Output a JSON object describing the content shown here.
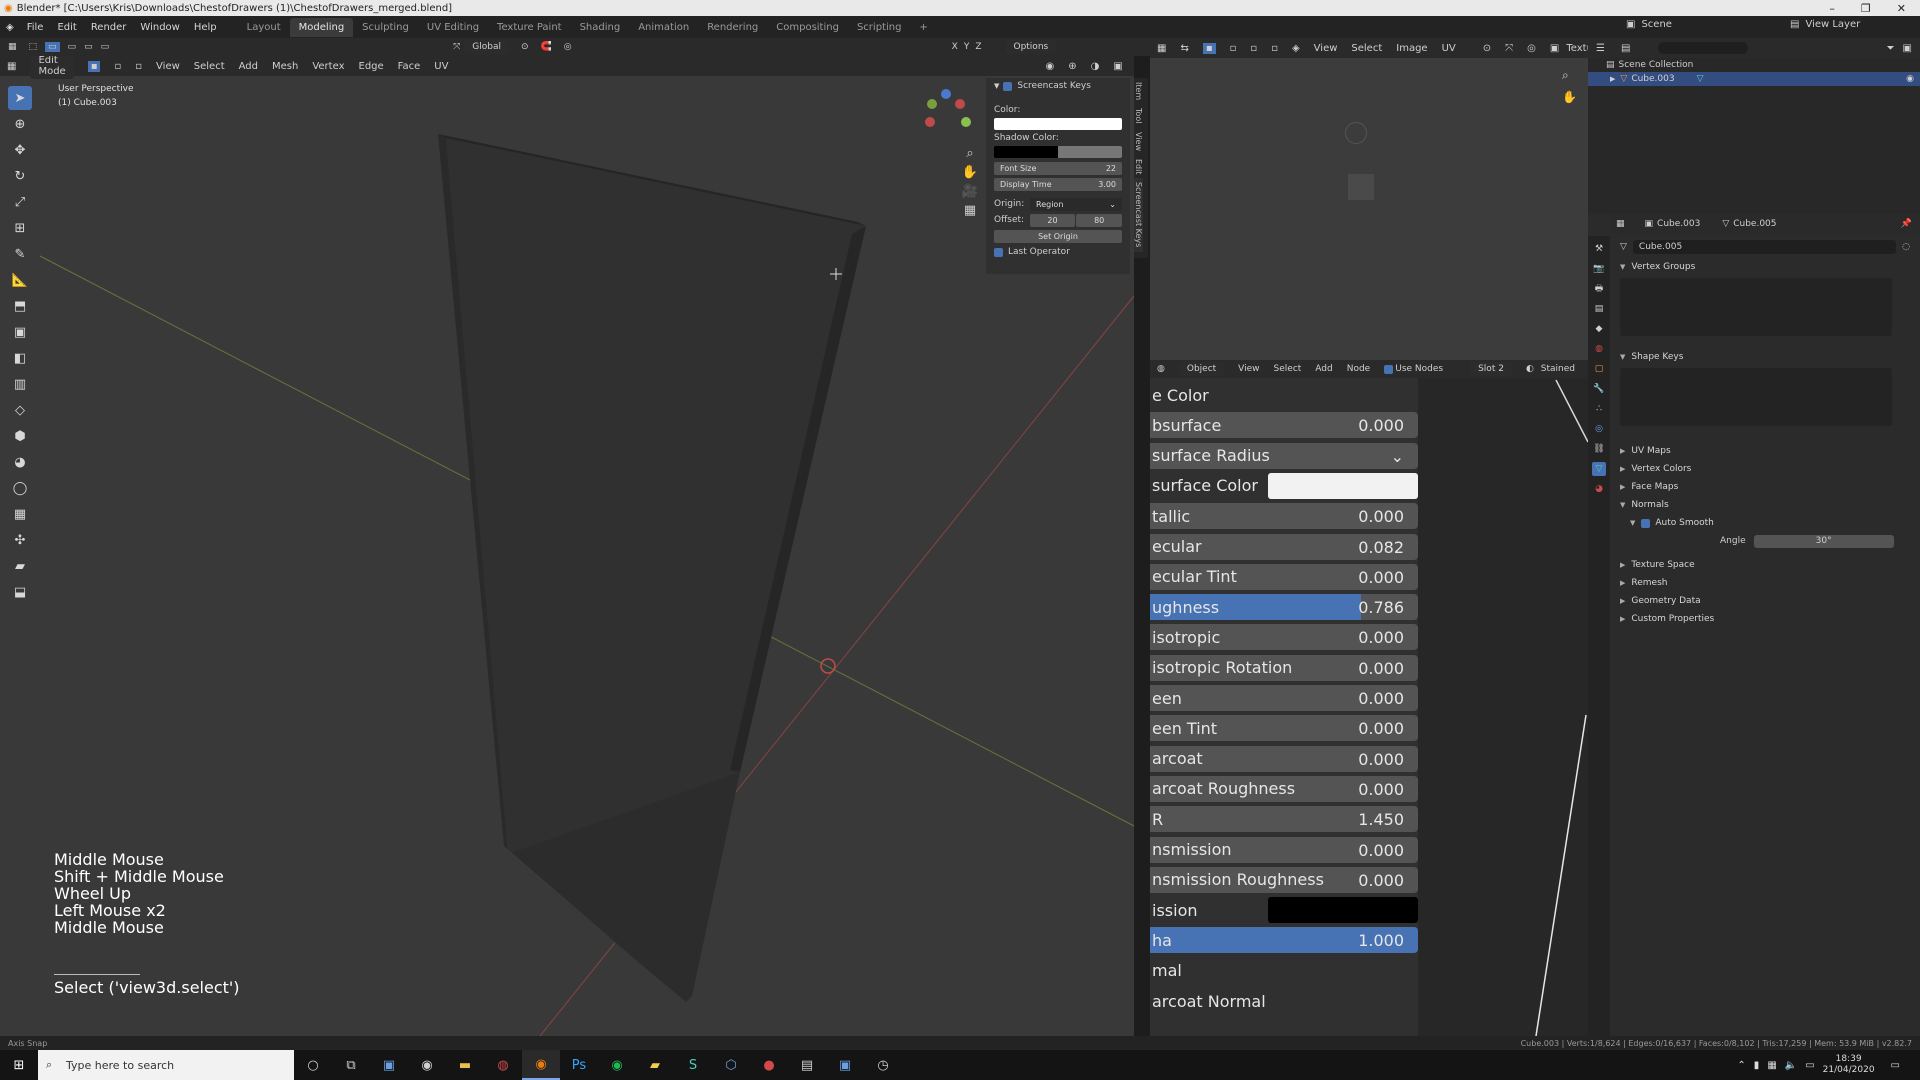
{
  "titlebar": {
    "title": "Blender* [C:\\Users\\Kris\\Downloads\\ChestofDrawers (1)\\ChestofDrawers_merged.blend]"
  },
  "topmenu": {
    "items": [
      "File",
      "Edit",
      "Render",
      "Window",
      "Help"
    ],
    "workspaces": [
      "Layout",
      "Modeling",
      "Sculpting",
      "UV Editing",
      "Texture Paint",
      "Shading",
      "Animation",
      "Rendering",
      "Compositing",
      "Scripting",
      "+"
    ],
    "active_workspace": "Modeling",
    "scene_label": "Scene",
    "view_layer_label": "View Layer"
  },
  "viewport_header": {
    "mode": "Edit Mode",
    "menus": [
      "View",
      "Select",
      "Add",
      "Mesh",
      "Vertex",
      "Edge",
      "Face",
      "UV"
    ],
    "transform": "Global",
    "options_label": "Options",
    "axes": [
      "X",
      "Y",
      "Z"
    ]
  },
  "viewport": {
    "perspective_label": "User Perspective",
    "object_label": "(1) Cube.003",
    "colors": {
      "x_axis": "#c04a4a",
      "y_axis": "#8a9a3e",
      "object": "#303030",
      "background": "#393939"
    }
  },
  "screencast_panel": {
    "title": "Screencast Keys",
    "color_label": "Color:",
    "shadow_label": "Shadow Color:",
    "font_size_label": "Font Size",
    "font_size_value": "22",
    "display_time_label": "Display Time",
    "display_time_value": "3.00",
    "origin_label": "Origin:",
    "origin_value": "Region",
    "offset_label": "Offset:",
    "offset_x": "20",
    "offset_y": "80",
    "set_origin_label": "Set Origin",
    "last_operator_label": "Last Operator",
    "sidebar_tabs": [
      "Item",
      "Tool",
      "View",
      "Edit",
      "Screencast Keys"
    ]
  },
  "overlay": {
    "keys": [
      "Middle Mouse",
      "Shift + Middle Mouse",
      "Wheel Up",
      "Left Mouse x2",
      "Middle Mouse"
    ],
    "operator": "Select ('view3d.select')"
  },
  "image_editor": {
    "menus": [
      "View",
      "Select",
      "Image",
      "UV"
    ],
    "extra_label": "Textu"
  },
  "node_editor": {
    "header": {
      "mode": "Object",
      "menus": [
        "View",
        "Select",
        "Add",
        "Node"
      ],
      "use_nodes": "Use Nodes",
      "slot": "Slot 2",
      "material": "Stained"
    },
    "props": [
      {
        "label": "e Color",
        "type": "label"
      },
      {
        "label": "bsurface",
        "value": "0.000",
        "type": "value"
      },
      {
        "label": "surface Radius",
        "type": "dropdown"
      },
      {
        "label": "surface Color",
        "type": "color",
        "color": "#f2f2f2"
      },
      {
        "label": "tallic",
        "value": "0.000",
        "type": "value"
      },
      {
        "label": "ecular",
        "value": "0.082",
        "type": "value"
      },
      {
        "label": "ecular Tint",
        "value": "0.000",
        "type": "value"
      },
      {
        "label": "ughness",
        "value": "0.786",
        "type": "slider",
        "fraction": 0.786
      },
      {
        "label": "isotropic",
        "value": "0.000",
        "type": "value"
      },
      {
        "label": "isotropic Rotation",
        "value": "0.000",
        "type": "value"
      },
      {
        "label": "een",
        "value": "0.000",
        "type": "value"
      },
      {
        "label": "een Tint",
        "value": "0.000",
        "type": "value"
      },
      {
        "label": "arcoat",
        "value": "0.000",
        "type": "value"
      },
      {
        "label": "arcoat Roughness",
        "value": "0.000",
        "type": "value"
      },
      {
        "label": "R",
        "value": "1.450",
        "type": "value"
      },
      {
        "label": "nsmission",
        "value": "0.000",
        "type": "value"
      },
      {
        "label": "nsmission Roughness",
        "value": "0.000",
        "type": "value"
      },
      {
        "label": "ission",
        "type": "color",
        "color": "#000000"
      },
      {
        "label": "ha",
        "value": "1.000",
        "type": "slider",
        "fraction": 1.0
      },
      {
        "label": "mal",
        "type": "label"
      },
      {
        "label": "arcoat Normal",
        "type": "label"
      }
    ]
  },
  "outliner": {
    "collection": "Scene Collection",
    "object": "Cube.003"
  },
  "properties": {
    "header_object": "Cube.003",
    "header_mesh": "Cube.005",
    "mesh_name": "Cube.005",
    "sections": {
      "vertex_groups": "Vertex Groups",
      "shape_keys": "Shape Keys",
      "uv_maps": "UV Maps",
      "vertex_colors": "Vertex Colors",
      "face_maps": "Face Maps",
      "normals": "Normals",
      "auto_smooth": "Auto Smooth",
      "angle_label": "Angle",
      "angle_value": "30°",
      "texture_space": "Texture Space",
      "remesh": "Remesh",
      "geometry_data": "Geometry Data",
      "custom_properties": "Custom Properties"
    }
  },
  "statusbar": {
    "left": "Axis Snap",
    "right": "Cube.003 | Verts:1/8,624 | Edges:0/16,637 | Faces:0/8,102 | Tris:17,259 | Mem: 53.9 MiB | v2.82.7"
  },
  "taskbar": {
    "search_placeholder": "Type here to search",
    "time": "18:39",
    "date": "21/04/2020"
  }
}
